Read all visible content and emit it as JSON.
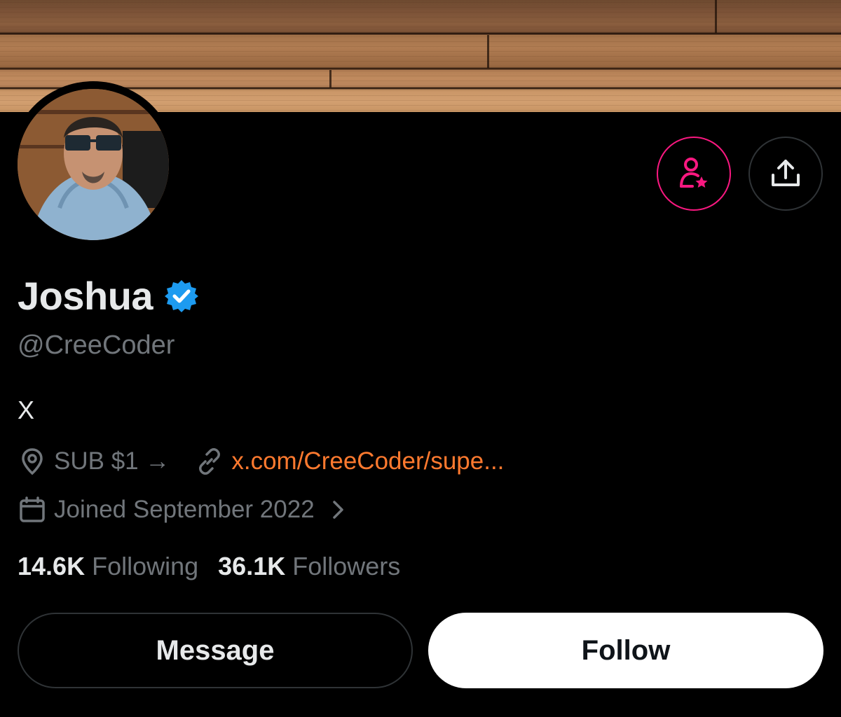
{
  "profile": {
    "name": "Joshua",
    "handle": "@CreeCoder",
    "bio": "X",
    "location": "SUB $1 →",
    "website": "x.com/CreeCoder/supe...",
    "joined": "Joined September 2022",
    "verified": true
  },
  "stats": {
    "following_count": "14.6K",
    "following_label": "Following",
    "followers_count": "36.1K",
    "followers_label": "Followers"
  },
  "actions": {
    "message_label": "Message",
    "follow_label": "Follow"
  },
  "icons": {
    "subscribe": "person-star-icon",
    "share": "share-icon",
    "verified": "verified-badge-icon",
    "location": "location-pin-icon",
    "link": "link-icon",
    "calendar": "calendar-icon",
    "chevron": "chevron-right-icon"
  },
  "colors": {
    "background": "#000000",
    "primary_text": "#e7e9ea",
    "secondary_text": "#71767b",
    "subscribe_accent": "#f91880",
    "link": "#ff7a2f",
    "verified": "#1d9bf0",
    "follow_button_bg": "#ffffff"
  }
}
